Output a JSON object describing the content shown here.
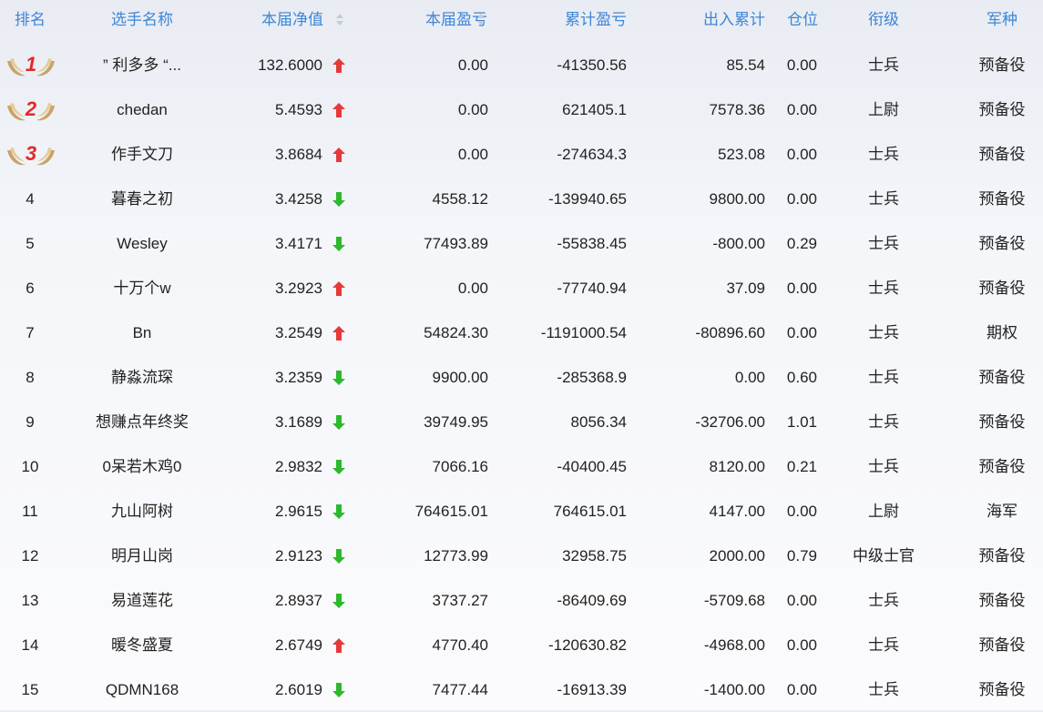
{
  "header": {
    "rank": "排名",
    "name": "选手名称",
    "nav": "本届净值",
    "profit": "本届盈亏",
    "cumulative": "累计盈亏",
    "io": "出入累计",
    "position": "仓位",
    "title": "衔级",
    "arm": "军种"
  },
  "colors": {
    "header_text": "#3d86d6",
    "up_arrow": "#e6393a",
    "down_arrow": "#2eb82e",
    "medal_number": "#e12a2a"
  },
  "rows": [
    {
      "rank": "1",
      "medal": true,
      "name": "” 利多多 “...",
      "nav": "132.6000",
      "dir": "up",
      "profit": "0.00",
      "cum": "-41350.56",
      "io": "85.54",
      "pos": "0.00",
      "title": "士兵",
      "arm": "预备役"
    },
    {
      "rank": "2",
      "medal": true,
      "name": "chedan",
      "nav": "5.4593",
      "dir": "up",
      "profit": "0.00",
      "cum": "621405.1",
      "io": "7578.36",
      "pos": "0.00",
      "title": "上尉",
      "arm": "预备役"
    },
    {
      "rank": "3",
      "medal": true,
      "name": "作手文刀",
      "nav": "3.8684",
      "dir": "up",
      "profit": "0.00",
      "cum": "-274634.3",
      "io": "523.08",
      "pos": "0.00",
      "title": "士兵",
      "arm": "预备役"
    },
    {
      "rank": "4",
      "medal": false,
      "name": "暮春之初",
      "nav": "3.4258",
      "dir": "down",
      "profit": "4558.12",
      "cum": "-139940.65",
      "io": "9800.00",
      "pos": "0.00",
      "title": "士兵",
      "arm": "预备役"
    },
    {
      "rank": "5",
      "medal": false,
      "name": "Wesley",
      "nav": "3.4171",
      "dir": "down",
      "profit": "77493.89",
      "cum": "-55838.45",
      "io": "-800.00",
      "pos": "0.29",
      "title": "士兵",
      "arm": "预备役"
    },
    {
      "rank": "6",
      "medal": false,
      "name": "十万个w",
      "nav": "3.2923",
      "dir": "up",
      "profit": "0.00",
      "cum": "-77740.94",
      "io": "37.09",
      "pos": "0.00",
      "title": "士兵",
      "arm": "预备役"
    },
    {
      "rank": "7",
      "medal": false,
      "name": "Bn",
      "nav": "3.2549",
      "dir": "up",
      "profit": "54824.30",
      "cum": "-1191000.54",
      "io": "-80896.60",
      "pos": "0.00",
      "title": "士兵",
      "arm": "期权"
    },
    {
      "rank": "8",
      "medal": false,
      "name": "静淼流琛",
      "nav": "3.2359",
      "dir": "down",
      "profit": "9900.00",
      "cum": "-285368.9",
      "io": "0.00",
      "pos": "0.60",
      "title": "士兵",
      "arm": "预备役"
    },
    {
      "rank": "9",
      "medal": false,
      "name": "想赚点年终奖",
      "nav": "3.1689",
      "dir": "down",
      "profit": "39749.95",
      "cum": "8056.34",
      "io": "-32706.00",
      "pos": "1.01",
      "title": "士兵",
      "arm": "预备役"
    },
    {
      "rank": "10",
      "medal": false,
      "name": "0呆若木鸡0",
      "nav": "2.9832",
      "dir": "down",
      "profit": "7066.16",
      "cum": "-40400.45",
      "io": "8120.00",
      "pos": "0.21",
      "title": "士兵",
      "arm": "预备役"
    },
    {
      "rank": "11",
      "medal": false,
      "name": "九山阿树",
      "nav": "2.9615",
      "dir": "down",
      "profit": "764615.01",
      "cum": "764615.01",
      "io": "4147.00",
      "pos": "0.00",
      "title": "上尉",
      "arm": "海军"
    },
    {
      "rank": "12",
      "medal": false,
      "name": "明月山岗",
      "nav": "2.9123",
      "dir": "down",
      "profit": "12773.99",
      "cum": "32958.75",
      "io": "2000.00",
      "pos": "0.79",
      "title": "中级士官",
      "arm": "预备役"
    },
    {
      "rank": "13",
      "medal": false,
      "name": "易道莲花",
      "nav": "2.8937",
      "dir": "down",
      "profit": "3737.27",
      "cum": "-86409.69",
      "io": "-5709.68",
      "pos": "0.00",
      "title": "士兵",
      "arm": "预备役"
    },
    {
      "rank": "14",
      "medal": false,
      "name": "暖冬盛夏",
      "nav": "2.6749",
      "dir": "up",
      "profit": "4770.40",
      "cum": "-120630.82",
      "io": "-4968.00",
      "pos": "0.00",
      "title": "士兵",
      "arm": "预备役"
    },
    {
      "rank": "15",
      "medal": false,
      "name": "QDMN168",
      "nav": "2.6019",
      "dir": "down",
      "profit": "7477.44",
      "cum": "-16913.39",
      "io": "-1400.00",
      "pos": "0.00",
      "title": "士兵",
      "arm": "预备役"
    }
  ]
}
